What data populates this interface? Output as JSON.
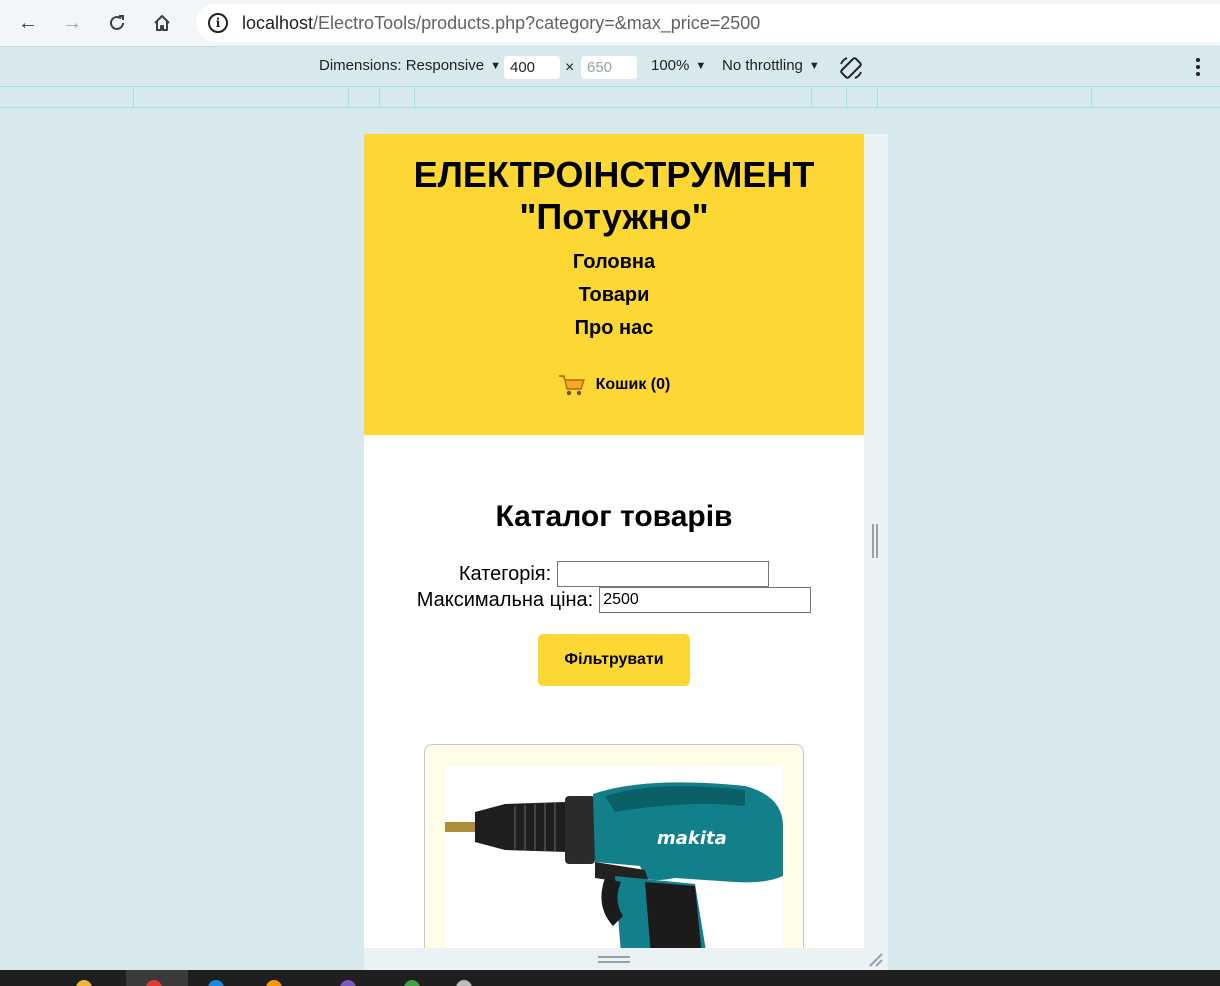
{
  "browser": {
    "url_host": "localhost",
    "url_path": "/ElectroTools/products.php?category=&max_price=2500"
  },
  "devtools": {
    "dimensions_label": "Dimensions: Responsive",
    "width": "400",
    "height": "650",
    "times": "×",
    "zoom": "100%",
    "throttling": "No throttling"
  },
  "site": {
    "brand_line1": "ЕЛЕКТРОІНСТРУМЕНТ",
    "brand_line2": "\"Потужно\"",
    "menu": [
      "Головна",
      "Товари",
      "Про нас"
    ],
    "cart_label": "Кошик (0)"
  },
  "catalog": {
    "title": "Каталог товарів",
    "category_label": "Категорія:",
    "category_value": "",
    "max_price_label": "Максимальна ціна:",
    "max_price_value": "2500",
    "filter_button": "Фільтрувати"
  },
  "product": {
    "image_brand": "makita"
  },
  "colors": {
    "accent": "#fdd835",
    "card_bg": "#fffde7",
    "drill_teal": "#12808a"
  }
}
